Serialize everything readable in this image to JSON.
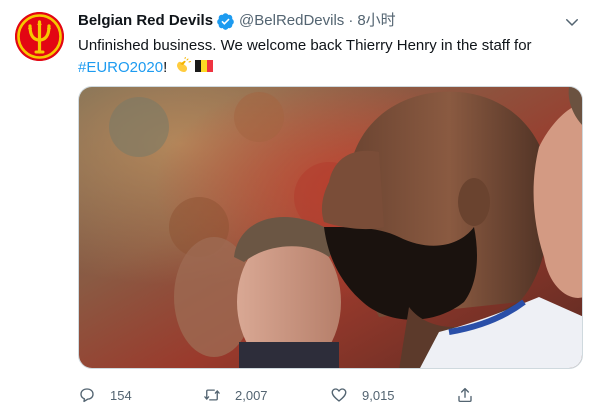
{
  "tweet": {
    "author": {
      "display_name": "Belgian Red Devils",
      "handle": "@BelRedDevils",
      "verified": true,
      "avatar_icon": "red-devils-trident-logo"
    },
    "separator": "·",
    "timestamp": "8小时",
    "text": {
      "line1": "Unfinished business. We welcome back Thierry Henry in the staff for",
      "hashtag": "#EURO2020",
      "suffix": "!"
    },
    "emojis": [
      "clapping-hands-emoji",
      "belgium-flag-emoji"
    ],
    "media": {
      "type": "photo",
      "icon": "photo-thierry-henry"
    },
    "actions": {
      "reply_count": "154",
      "retweet_count": "2,007",
      "like_count": "9,015"
    },
    "colors": {
      "accent": "#1d9bf0",
      "secondary_text": "#536471",
      "avatar_bg": "#e30613",
      "trident": "#f6c800"
    }
  }
}
